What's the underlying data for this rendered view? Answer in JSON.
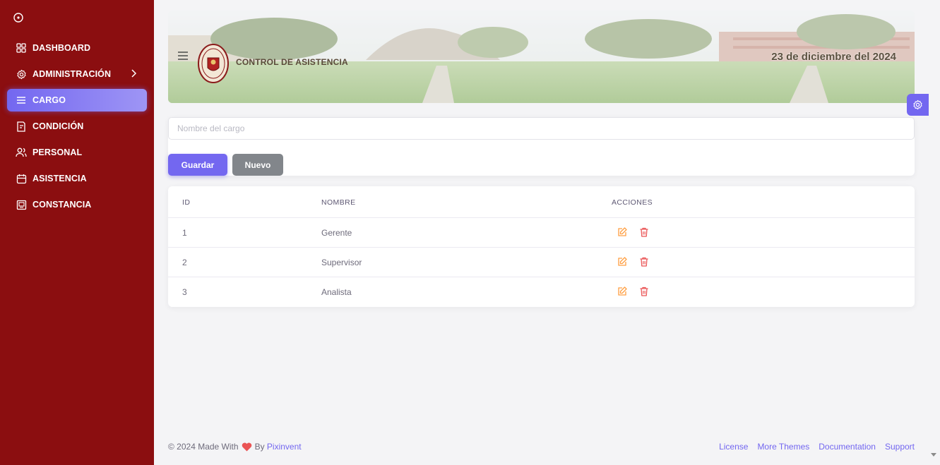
{
  "sidebar": {
    "items": [
      {
        "label": "DASHBOARD",
        "icon": "dashboard-icon"
      },
      {
        "label": "ADMINISTRACIÓN",
        "icon": "settings-icon"
      },
      {
        "label": "CARGO",
        "icon": "list-icon"
      },
      {
        "label": "CONDICIÓN",
        "icon": "document-icon"
      },
      {
        "label": "PERSONAL",
        "icon": "users-icon"
      },
      {
        "label": "ASISTENCIA",
        "icon": "calendar-icon"
      },
      {
        "label": "CONSTANCIA",
        "icon": "certificate-icon"
      }
    ],
    "active": "CARGO"
  },
  "header": {
    "title": "CONTROL DE ASISTENCIA",
    "date": "23 de diciembre del 2024"
  },
  "form": {
    "placeholder": "Nombre del cargo",
    "value": "",
    "save_label": "Guardar",
    "new_label": "Nuevo"
  },
  "table": {
    "columns": [
      "ID",
      "NOMBRE",
      "ACCIONES"
    ],
    "rows": [
      {
        "id": "1",
        "nombre": "Gerente"
      },
      {
        "id": "2",
        "nombre": "Supervisor"
      },
      {
        "id": "3",
        "nombre": "Analista"
      }
    ]
  },
  "footer": {
    "prefix": "© 2024 Made With",
    "by": "By",
    "author": "Pixinvent",
    "links": [
      "License",
      "More Themes",
      "Documentation",
      "Support"
    ]
  },
  "colors": {
    "sidebar": "#8b0e10",
    "primary": "#7367f0",
    "secondary": "#82868b",
    "edit": "#ff9f43",
    "delete": "#ea5455"
  }
}
